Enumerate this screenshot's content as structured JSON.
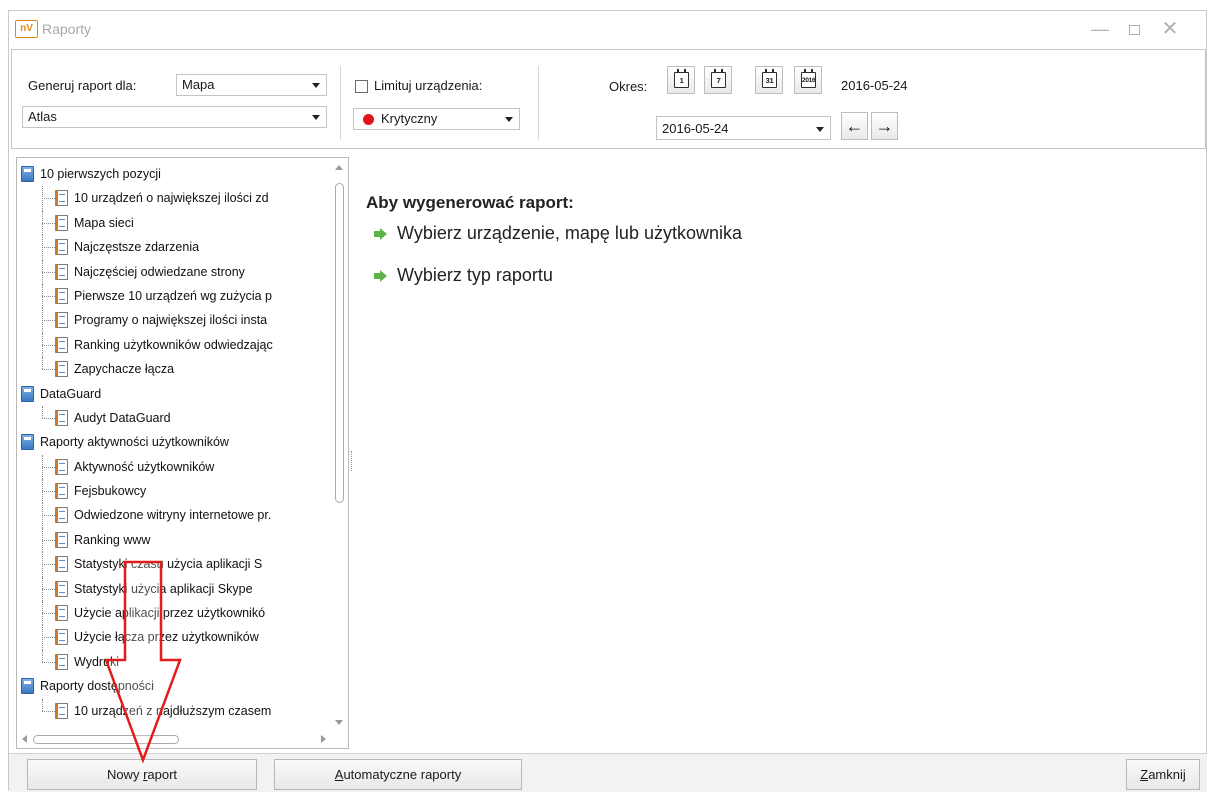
{
  "window": {
    "title": "Raporty",
    "logo_text": "nV"
  },
  "toolbar": {
    "generate_label": "Generuj raport dla:",
    "generate_value": "Mapa",
    "target_value": "Atlas",
    "limit_label": "Limituj urządzenia:",
    "limit_checked": false,
    "severity_value": "Krytyczny",
    "severity_color": "#e0141a",
    "period_label": "Okres:",
    "period_buttons": [
      "1",
      "7",
      "31",
      "2016"
    ],
    "current_date_text": "2016-05-24",
    "date_value": "2016-05-24"
  },
  "tree": [
    {
      "type": "folder",
      "label": "10 pierwszych pozycji"
    },
    {
      "type": "doc",
      "label": "10 urządzeń o największej ilości zd"
    },
    {
      "type": "doc",
      "label": "Mapa sieci"
    },
    {
      "type": "doc",
      "label": "Najczęstsze zdarzenia"
    },
    {
      "type": "doc",
      "label": "Najczęściej odwiedzane strony"
    },
    {
      "type": "doc",
      "label": "Pierwsze 10 urządzeń wg zużycia p"
    },
    {
      "type": "doc",
      "label": "Programy o największej ilości insta"
    },
    {
      "type": "doc",
      "label": "Ranking użytkowników odwiedzając"
    },
    {
      "type": "doc",
      "label": "Zapychacze łącza"
    },
    {
      "type": "folder",
      "label": "DataGuard"
    },
    {
      "type": "doc",
      "label": "Audyt DataGuard"
    },
    {
      "type": "folder",
      "label": "Raporty aktywności użytkowników"
    },
    {
      "type": "doc",
      "label": "Aktywność użytkowników"
    },
    {
      "type": "doc",
      "label": "Fejsbukowcy"
    },
    {
      "type": "doc",
      "label": "Odwiedzone witryny internetowe pr."
    },
    {
      "type": "doc",
      "label": "Ranking www"
    },
    {
      "type": "doc",
      "label": "Statystyki czasu użycia aplikacji S"
    },
    {
      "type": "doc",
      "label": "Statystyki użycia aplikacji Skype"
    },
    {
      "type": "doc",
      "label": "Użycie aplikacji przez użytkownikó"
    },
    {
      "type": "doc",
      "label": "Użycie łącza przez użytkowników"
    },
    {
      "type": "doc",
      "label": "Wydruki"
    },
    {
      "type": "folder",
      "label": "Raporty dostępności"
    },
    {
      "type": "doc",
      "label": "10 urządzeń z najdłuższym czasem"
    }
  ],
  "instructions": {
    "title": "Aby wygenerować raport:",
    "items": [
      "Wybierz urządzenie, mapę lub użytkownika",
      "Wybierz typ raportu"
    ]
  },
  "buttons": {
    "new_report_prefix": "Nowy ",
    "new_report_accel": "r",
    "new_report_suffix": "aport",
    "auto_accel": "A",
    "auto_suffix": "utomatyczne raporty",
    "close_accel": "Z",
    "close_suffix": "amknij"
  }
}
